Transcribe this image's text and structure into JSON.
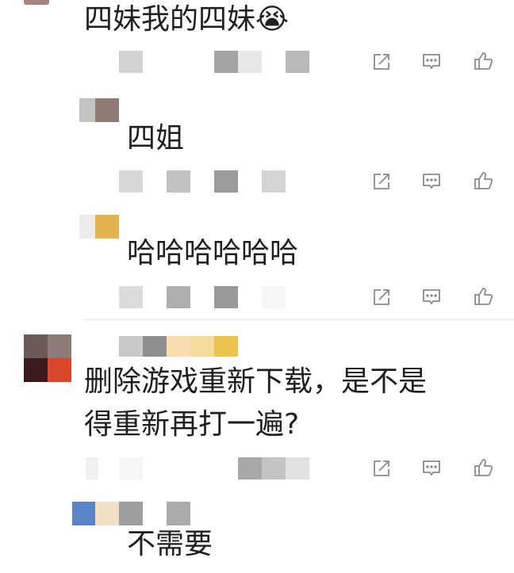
{
  "comments": [
    {
      "text": "四妹我的四妹😭"
    },
    {
      "text": "四姐"
    },
    {
      "text": "哈哈哈哈哈哈"
    },
    {
      "text_line1": "删除游戏重新下载，是不是",
      "text_line2": "得重新再打一遍?"
    },
    {
      "text": "不需要"
    }
  ],
  "icons": {
    "share": "share-icon",
    "reply": "comment-icon",
    "like": "thumbs-up-icon"
  },
  "colors": {
    "text": "#1f1f1f",
    "icon_gray": "#8a8a8a",
    "avatar_brown": "#a58581",
    "avatar_orange": "#e2b450",
    "avatar_red": "#d9482a",
    "avatar_blue": "#5a86c8"
  }
}
